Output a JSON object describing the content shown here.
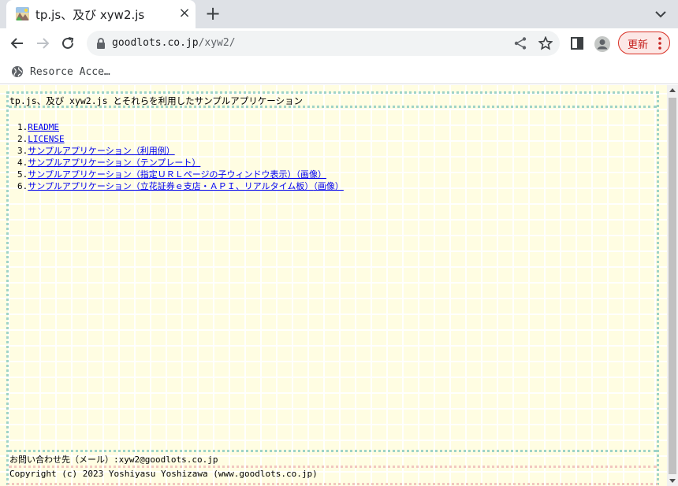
{
  "tab": {
    "title": "tp.js、及び xyw2.js",
    "favicon": "landscape-favicon-icon",
    "close": "×",
    "new_tab": "+"
  },
  "toolbar": {
    "url_host": "goodlots.co.jp",
    "url_path": "/xyw2/",
    "update_label": "更新",
    "accent_color": "#d93025"
  },
  "bookmarks": {
    "items": [
      {
        "label": "Resorce Acce…",
        "icon": "globe-icon"
      }
    ]
  },
  "page": {
    "title": "tp.js、及び xyw2.js とそれらを利用したサンプルアプリケーション",
    "menu": [
      {
        "num": "1.",
        "links": [
          "README"
        ]
      },
      {
        "num": "2.",
        "links": [
          "LICENSE"
        ]
      },
      {
        "num": "3.",
        "links": [
          "サンプルアプリケーション（利用例）"
        ]
      },
      {
        "num": "4.",
        "links": [
          "サンプルアプリケーション（テンプレート）"
        ]
      },
      {
        "num": "5.",
        "links": [
          "サンプルアプリケーション（指定ＵＲＬページの子ウィンドウ表示）",
          "（画像）"
        ]
      },
      {
        "num": "6.",
        "links": [
          "サンプルアプリケーション（立花証券ｅ支店・ＡＰＩ、リアルタイム板）",
          "（画像）"
        ]
      }
    ],
    "contact": "お問い合わせ先（メール）:xyw2@goodlots.co.jp",
    "copyright": "Copyright (c) 2023 Yoshiyasu Yoshizawa (www.goodlots.co.jp)",
    "background_color": "#fffde2",
    "link_color": "#0000ee"
  }
}
